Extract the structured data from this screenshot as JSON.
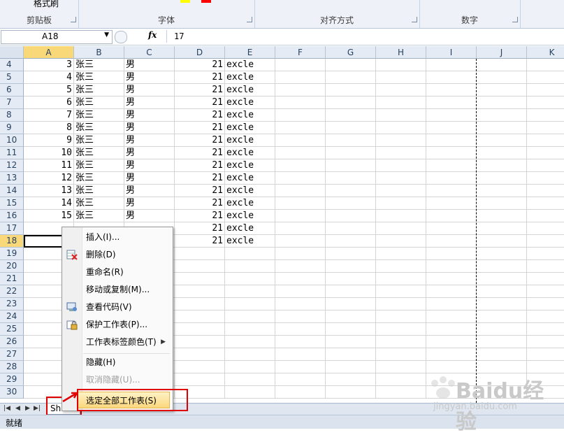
{
  "ribbon": {
    "clipboard": {
      "label": "剪贴板",
      "format_painter": "格式刷"
    },
    "font": {
      "label": "字体"
    },
    "alignment": {
      "label": "对齐方式"
    },
    "number": {
      "label": "数字"
    }
  },
  "formula_bar": {
    "name_box": "A18",
    "fx": "fx",
    "content": "17"
  },
  "columns": [
    "A",
    "B",
    "C",
    "D",
    "E",
    "F",
    "G",
    "H",
    "I",
    "J",
    "K"
  ],
  "selected_column": "A",
  "rows": [
    {
      "n": "4",
      "a": "3",
      "b": "张三",
      "c": "男",
      "d": "21",
      "e": "excle"
    },
    {
      "n": "5",
      "a": "4",
      "b": "张三",
      "c": "男",
      "d": "21",
      "e": "excle"
    },
    {
      "n": "6",
      "a": "5",
      "b": "张三",
      "c": "男",
      "d": "21",
      "e": "excle"
    },
    {
      "n": "7",
      "a": "6",
      "b": "张三",
      "c": "男",
      "d": "21",
      "e": "excle"
    },
    {
      "n": "8",
      "a": "7",
      "b": "张三",
      "c": "男",
      "d": "21",
      "e": "excle"
    },
    {
      "n": "9",
      "a": "8",
      "b": "张三",
      "c": "男",
      "d": "21",
      "e": "excle"
    },
    {
      "n": "10",
      "a": "9",
      "b": "张三",
      "c": "男",
      "d": "21",
      "e": "excle"
    },
    {
      "n": "11",
      "a": "10",
      "b": "张三",
      "c": "男",
      "d": "21",
      "e": "excle"
    },
    {
      "n": "12",
      "a": "11",
      "b": "张三",
      "c": "男",
      "d": "21",
      "e": "excle"
    },
    {
      "n": "13",
      "a": "12",
      "b": "张三",
      "c": "男",
      "d": "21",
      "e": "excle"
    },
    {
      "n": "14",
      "a": "13",
      "b": "张三",
      "c": "男",
      "d": "21",
      "e": "excle"
    },
    {
      "n": "15",
      "a": "14",
      "b": "张三",
      "c": "男",
      "d": "21",
      "e": "excle"
    },
    {
      "n": "16",
      "a": "15",
      "b": "张三",
      "c": "男",
      "d": "21",
      "e": "excle"
    },
    {
      "n": "17",
      "a": "",
      "b": "",
      "c": "",
      "d": "21",
      "e": "excle"
    },
    {
      "n": "18",
      "a": "",
      "b": "",
      "c": "",
      "d": "21",
      "e": "excle"
    },
    {
      "n": "19"
    },
    {
      "n": "20"
    },
    {
      "n": "21"
    },
    {
      "n": "22"
    },
    {
      "n": "23"
    },
    {
      "n": "24"
    },
    {
      "n": "25"
    },
    {
      "n": "26"
    },
    {
      "n": "27"
    },
    {
      "n": "28"
    },
    {
      "n": "29"
    },
    {
      "n": "30"
    }
  ],
  "context_menu": {
    "insert": "插入(I)...",
    "delete": "删除(D)",
    "rename": "重命名(R)",
    "move_copy": "移动或复制(M)...",
    "view_code": "查看代码(V)",
    "protect": "保护工作表(P)...",
    "tab_color": "工作表标签颜色(T)",
    "hide": "隐藏(H)",
    "unhide": "取消隐藏(U)...",
    "select_all": "选定全部工作表(S)"
  },
  "sheet_tab": {
    "label": "Shee"
  },
  "status": {
    "text": "就绪"
  },
  "watermark": {
    "brand": "Baidu经验",
    "url": "jingyan.baidu.com"
  }
}
